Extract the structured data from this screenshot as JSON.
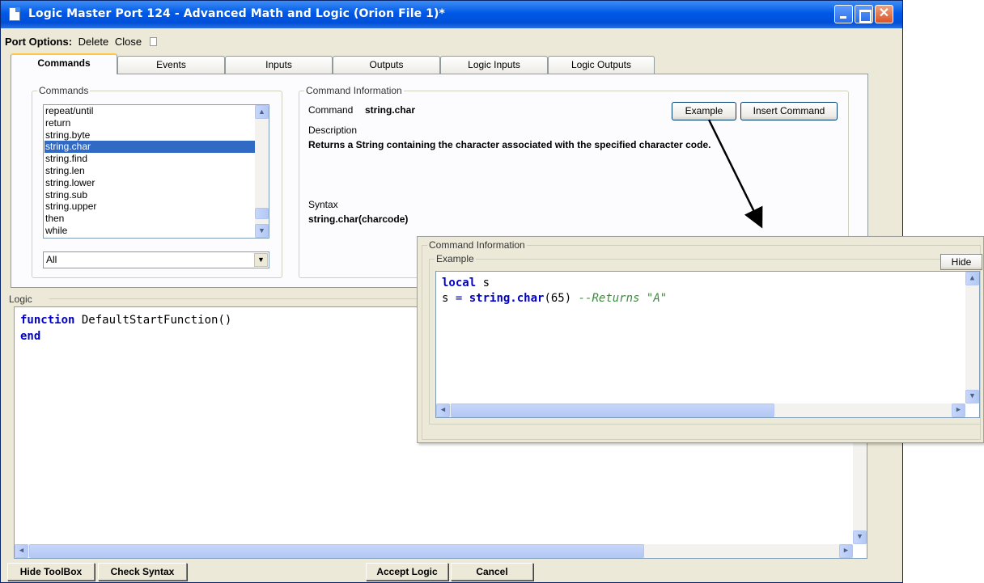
{
  "window": {
    "title": "Logic Master Port 124 - Advanced Math and Logic (Orion File 1)*",
    "controls": {
      "minimize": "",
      "maximize": "",
      "close": "✕"
    }
  },
  "port_options": {
    "label": "Port Options:",
    "delete": "Delete",
    "close": "Close"
  },
  "tabs": [
    "Commands",
    "Events",
    "Inputs",
    "Outputs",
    "Logic Inputs",
    "Logic Outputs"
  ],
  "commands_group": {
    "label": "Commands",
    "items": [
      "repeat/until",
      "return",
      "string.byte",
      "string.char",
      "string.find",
      "string.len",
      "string.lower",
      "string.sub",
      "string.upper",
      "then",
      "while"
    ],
    "selected": "string.char",
    "filter_value": "All"
  },
  "command_info": {
    "label": "Command Information",
    "command_label": "Command",
    "command_value": "string.char",
    "description_label": "Description",
    "description_value": "Returns a String containing the character associated with the specified character code.",
    "syntax_label": "Syntax",
    "syntax_value": "string.char(charcode)",
    "example_button": "Example",
    "insert_button": "Insert Command"
  },
  "logic": {
    "label": "Logic",
    "line1_kw": "function",
    "line1_rest": " DefaultStartFunction()",
    "line2_kw": "end"
  },
  "bottom_buttons": {
    "hide_toolbox": "Hide ToolBox",
    "check_syntax": "Check Syntax",
    "accept_logic": "Accept Logic",
    "cancel": "Cancel"
  },
  "popup": {
    "outer_label": "Command Information",
    "inner_label": "Example",
    "hide_button": "Hide",
    "code_line1_kw": "local",
    "code_line1_rest": " s",
    "code_line2_a": "s ",
    "code_line2_eq": "=",
    "code_line2_fn": " string.char",
    "code_line2_args": "(65) ",
    "code_line2_comment": "--Returns \"A\""
  },
  "colors": {
    "title_bar": "#0058e6",
    "selection": "#316ac5",
    "keyword": "#0000c8",
    "comment": "#3d8a3d"
  }
}
